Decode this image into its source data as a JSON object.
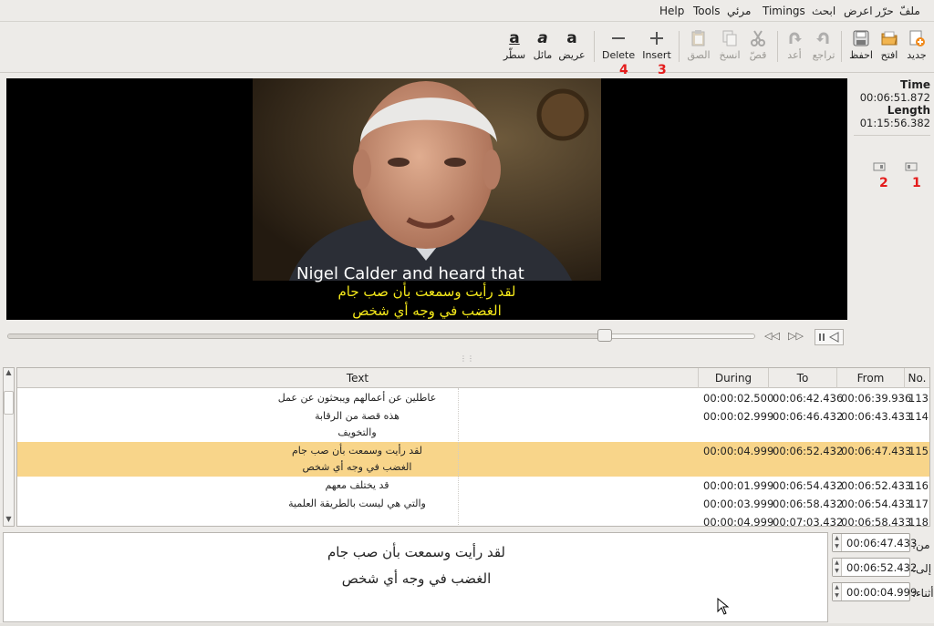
{
  "menu": [
    "ملفّ",
    "حرّر",
    "اعرض",
    "ابحث",
    "Timings",
    "مرئي",
    "Tools",
    "Help"
  ],
  "toolbar": {
    "new": "جديد",
    "open": "افتح",
    "save": "احفظ",
    "undo": "تراجع",
    "redo": "أعد",
    "cut": "قصّ",
    "copy": "انسخ",
    "paste": "الصق",
    "insert": "Insert",
    "delete": "Delete",
    "bold": "عريض",
    "italic": "مائل",
    "underline": "سطّر",
    "bold_glyph": "a",
    "italic_glyph": "a",
    "underline_glyph": "a"
  },
  "annotations": {
    "n1": "1",
    "n2": "2",
    "n3": "3",
    "n4": "4"
  },
  "info": {
    "time_label": "Time",
    "time_value": "00:06:51.872",
    "length_label": "Length",
    "length_value": "01:15:56.382"
  },
  "video": {
    "subtitle_en": "Nigel Calder  and heard that",
    "subtitle_ar_1": "لقد رأيت وسمعت بأن صب جام",
    "subtitle_ar_2": "الغضب في وجه أي شخص",
    "seek_fraction": 0.8
  },
  "table": {
    "headers": {
      "no": "No.",
      "from": "From",
      "to": "To",
      "during": "During",
      "text": "Text"
    },
    "rows": [
      {
        "no": "113",
        "from": "00:06:39.936",
        "to": "00:06:42.436",
        "during": "00:00:02.500",
        "text": [
          "عاطلين عن أعمالهم ويبحثون عن عمل"
        ]
      },
      {
        "no": "114",
        "from": "00:06:43.433",
        "to": "00:06:46.432",
        "during": "00:00:02.999",
        "text": [
          "هذه قصة من الرقابة",
          "والتخويف"
        ]
      },
      {
        "no": "115",
        "from": "00:06:47.433",
        "to": "00:06:52.432",
        "during": "00:00:04.999",
        "text": [
          "لقد رأيت وسمعت بأن صب جام",
          "الغضب في وجه أي شخص"
        ]
      },
      {
        "no": "116",
        "from": "00:06:52.433",
        "to": "00:06:54.432",
        "during": "00:00:01.999",
        "text": [
          "قد يختلف معهم"
        ]
      },
      {
        "no": "117",
        "from": "00:06:54.433",
        "to": "00:06:58.432",
        "during": "00:00:03.999",
        "text": [
          "والتي هي ليست بالطريقة العلمية"
        ]
      },
      {
        "no": "118",
        "from": "00:06:58.433",
        "to": "00:07:03.432",
        "during": "00:00:04.999",
        "text": [
          ""
        ]
      }
    ]
  },
  "editor": {
    "line1": "لقد رأيت وسمعت بأن صب جام",
    "line2": "الغضب في وجه أي شخص",
    "from_label": "من:",
    "to_label": "إلى:",
    "during_label": "أثناء:",
    "from_value": "00:06:47.433",
    "to_value": "00:06:52.432",
    "during_value": "00:00:04.999"
  },
  "colors": {
    "selected_row": "#f8d58a",
    "subtitle": "#f4e81a",
    "annotation": "#e41c1c"
  }
}
